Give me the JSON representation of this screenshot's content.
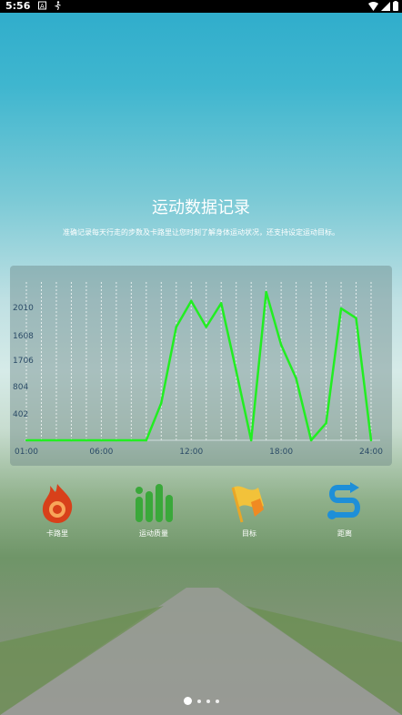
{
  "status_bar": {
    "time": "5:56"
  },
  "header": {
    "title": "运动数据记录",
    "subtitle": "准确记录每天行走的步数及卡路里让您时刻了解身体运动状况，还支持设定运动目标。"
  },
  "chart_data": {
    "type": "line",
    "x": [
      0,
      1,
      2,
      3,
      4,
      5,
      6,
      7,
      8,
      9,
      10,
      11,
      12,
      13,
      14,
      15,
      16,
      17,
      18,
      19,
      20,
      21,
      22,
      23
    ],
    "x_tick_labels": [
      "01:00",
      "06:00",
      "12:00",
      "18:00",
      "24:00"
    ],
    "y_tick_labels": [
      "2010",
      "1608",
      "1706",
      "804",
      "402"
    ],
    "series": [
      {
        "values": [
          0,
          0,
          0,
          0,
          0,
          0,
          0,
          0,
          0,
          500,
          1520,
          1870,
          1520,
          1840,
          930,
          0,
          1990,
          1280,
          830,
          0,
          230,
          1770,
          1640,
          0
        ]
      }
    ],
    "line_color": "#22ee22",
    "grid": true
  },
  "features": [
    {
      "label": "卡路里",
      "icon": "flame-icon"
    },
    {
      "label": "运动质量",
      "icon": "bars-icon"
    },
    {
      "label": "目标",
      "icon": "flag-icon"
    },
    {
      "label": "距离",
      "icon": "route-icon"
    }
  ],
  "pager": {
    "count": 4,
    "active": 0
  }
}
